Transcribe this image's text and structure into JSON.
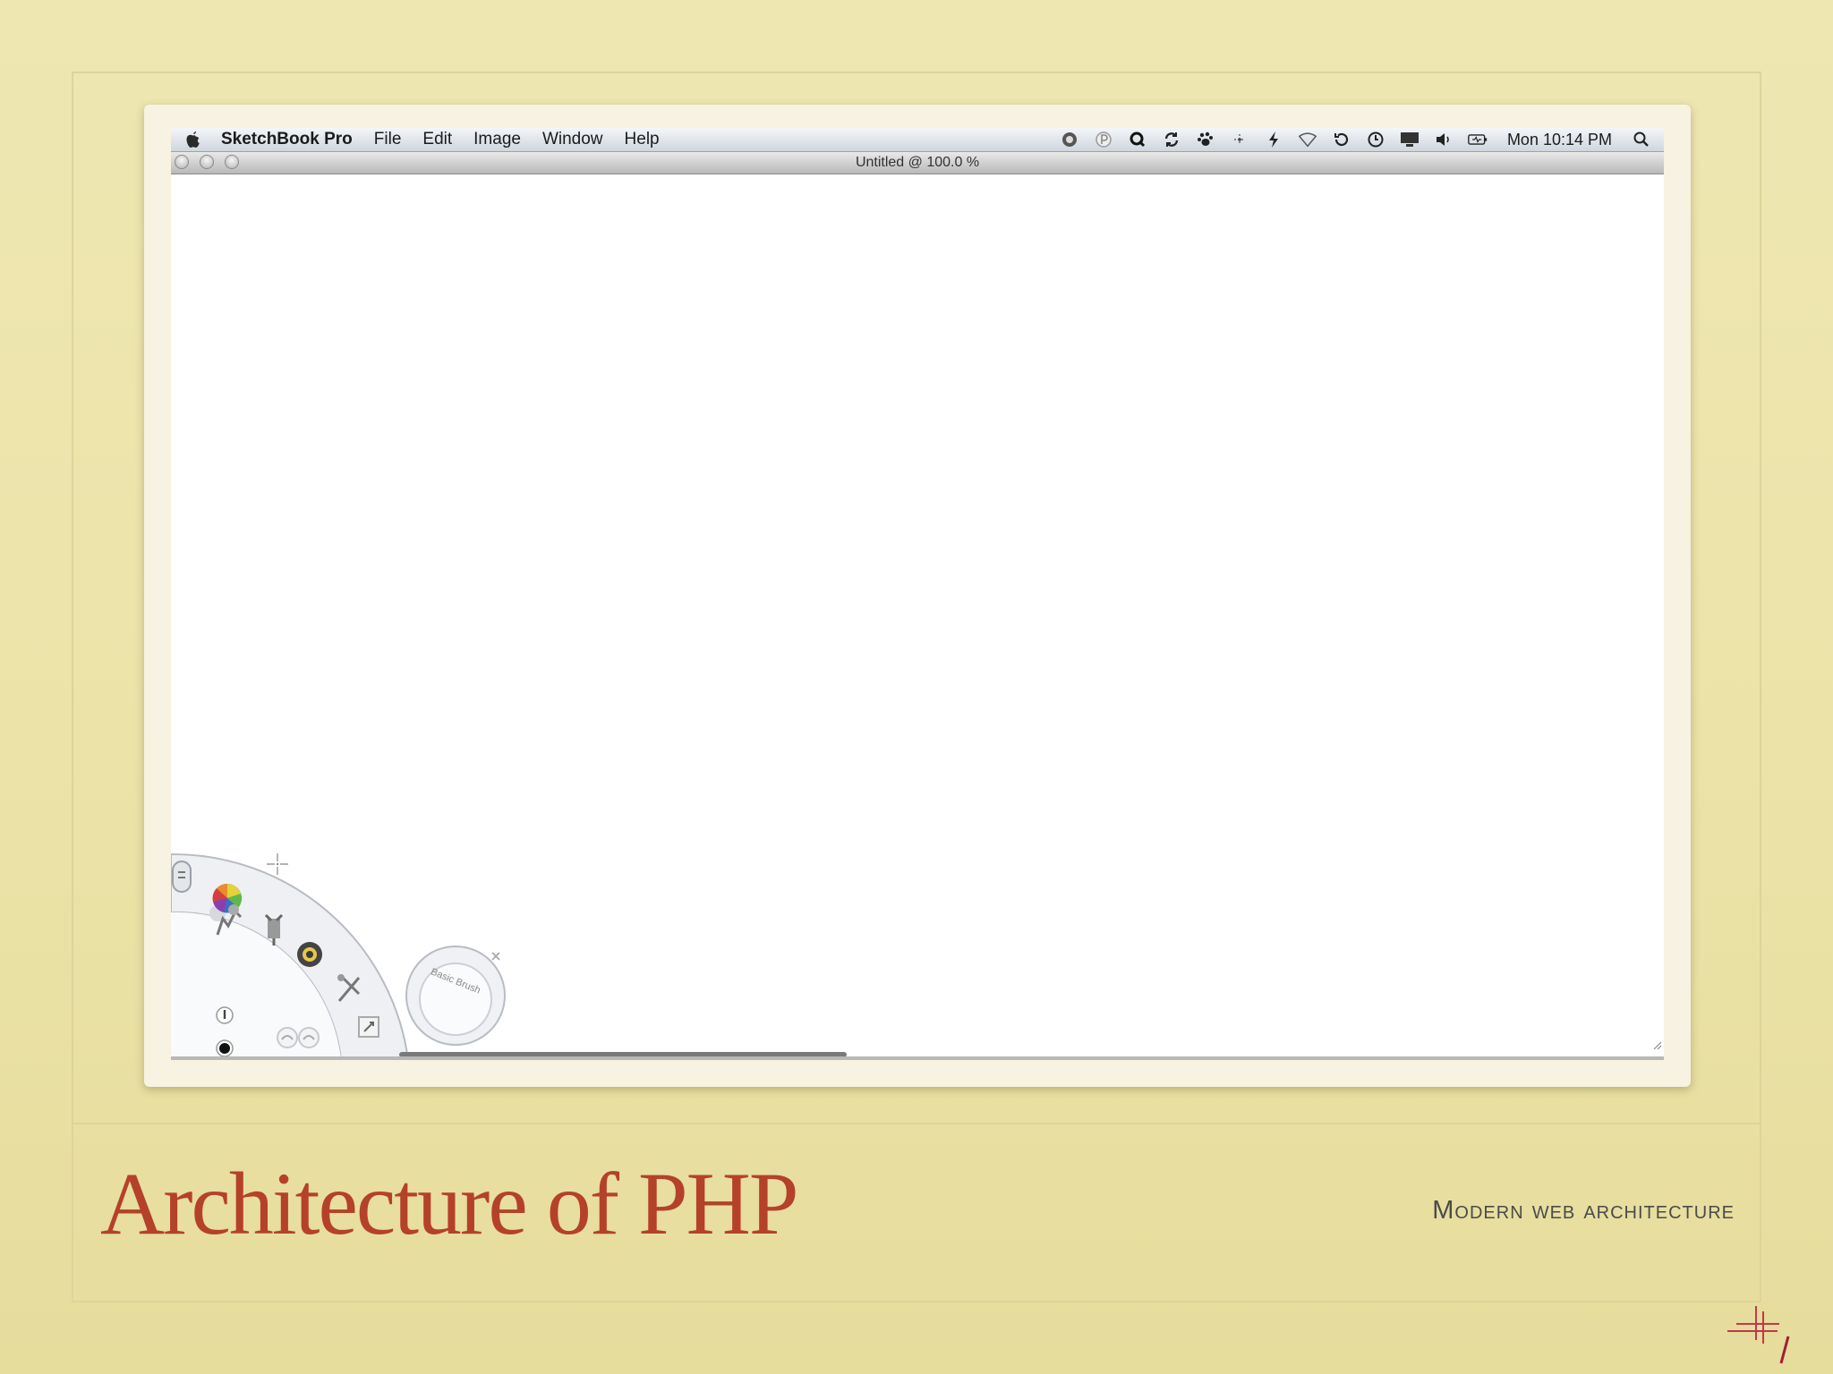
{
  "menubar": {
    "app_name": "SketchBook Pro",
    "items": [
      "File",
      "Edit",
      "Image",
      "Window",
      "Help"
    ],
    "status_icons": [
      "quicksilver-icon",
      "pathfinder-icon",
      "q-icon",
      "sync-icon",
      "paw-icon",
      "move-icon",
      "bolt-icon",
      "wifi-icon",
      "time-machine-icon",
      "clock-icon",
      "display-icon",
      "volume-icon",
      "battery-icon"
    ],
    "clock": "Mon 10:14 PM"
  },
  "window": {
    "title": "Untitled @ 100.0 %"
  },
  "brush_puck": {
    "label": "Basic Brush"
  },
  "slide": {
    "title": "Architecture of PHP",
    "subtitle": "Modern web architecture"
  },
  "colors": {
    "background": "#ece4aa",
    "title": "#b5412a",
    "subtitle": "#4b4b4b"
  }
}
